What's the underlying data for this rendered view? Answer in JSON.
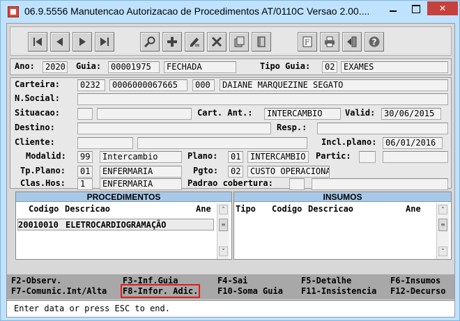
{
  "window": {
    "title": "06.9.5556 Manutencao Autorizacao de Procedimentos AT/0110C Versao 2.00....",
    "minimize_glyph": "",
    "maximize_glyph": "",
    "close_glyph": "✕"
  },
  "toolbar": {
    "buttons": [
      "first-icon",
      "previous-icon",
      "next-icon",
      "last-icon",
      "search-icon",
      "add-icon",
      "edit-icon",
      "delete-icon",
      "documents-icon",
      "exit-door-icon",
      "filter-icon",
      "print-icon",
      "return-icon",
      "help-icon"
    ]
  },
  "header": {
    "ano_label": "Ano:",
    "ano": "2020",
    "guia_label": "Guia:",
    "guia": "00001975",
    "status": "FECHADA",
    "tipo_guia_label": "Tipo Guia:",
    "tipo_guia_code": "02",
    "tipo_guia": "EXAMES"
  },
  "form": {
    "carteira_label": "Carteira:",
    "carteira_1": "0232",
    "carteira_2": "0006000067665",
    "carteira_3": "000",
    "beneficiario": "DAIANE MARQUEZINE SEGATO",
    "nsocial_label": "N.Social:",
    "nsocial": "",
    "situacao_label": "Situacao:",
    "situacao_code": "",
    "situacao": "",
    "cart_ant_label": "Cart. Ant.:",
    "cart_ant": "INTERCAMBIO",
    "valid_label": "Valid:",
    "valid": "30/06/2015",
    "destino_label": "Destino:",
    "destino": "",
    "resp_label": "Resp.:",
    "resp": "",
    "cliente_label": "Cliente:",
    "cliente_code": "",
    "cliente": "",
    "incl_plano_label": "Incl.plano:",
    "incl_plano": "06/01/2016",
    "modalid_label": "Modalid:",
    "modalid_code": "99",
    "modalid": "Intercambio",
    "plano_label": "Plano:",
    "plano_code": "01",
    "plano": "INTERCAMBIO",
    "partic_label": "Partic:",
    "partic": "",
    "tp_plano_label": "Tp.Plano:",
    "tp_plano_code": "01",
    "tp_plano": "ENFERMARIA",
    "pgto_label": "Pgto:",
    "pgto_code": "02",
    "pgto": "CUSTO OPERACIONAL",
    "clas_hos_label": "Clas.Hos:",
    "clas_hos_code": "1",
    "clas_hos": "ENFERMARIA",
    "padrao_label": "Padrao cobertura:",
    "padrao_code": "",
    "padrao": ""
  },
  "procedimentos": {
    "title": "PROCEDIMENTOS",
    "columns": [
      "Codigo",
      "Descricao",
      "Ane"
    ],
    "rows": [
      {
        "codigo": "20010010",
        "descricao": "ELETROCARDIOGRAMAÇÃO",
        "ane": ""
      }
    ]
  },
  "insumos": {
    "title": "INSUMOS",
    "columns": [
      "Tipo",
      "Codigo",
      "Descricao",
      "Ane"
    ],
    "rows": []
  },
  "scroll": {
    "up": "˄",
    "down": "˅",
    "thumb": "≡"
  },
  "fkeys": {
    "f2": "F2-Observ.",
    "f3": "F3-Inf.Guia",
    "f4": "F4-Sai",
    "f5": "F5-Detalhe",
    "f6": "F6-Insumos",
    "f7": "F7-Comunic.Int/Alta",
    "f8": "F8-Infor. Adic.",
    "f10": "F10-Soma Guia",
    "f11": "F11-Insistencia",
    "f12": "F12-Decurso"
  },
  "status_text": "Enter data or press ESC to end.",
  "colors": {
    "title_bar": "#bfe3ff",
    "close_button": "#c7413c",
    "grid_header": "#a9c8e8",
    "highlight": "#e01b1b"
  }
}
